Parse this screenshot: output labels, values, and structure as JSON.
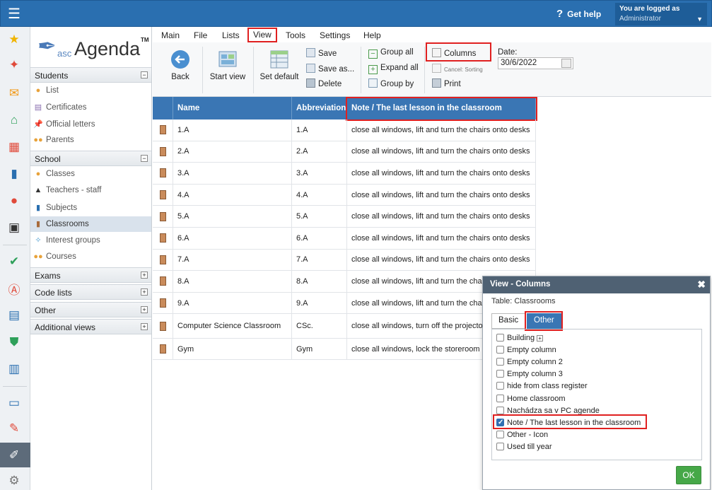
{
  "topbar": {
    "get_help": "Get help",
    "logged_as": "You are logged as",
    "user": "Administrator"
  },
  "logo": {
    "asc": "asc",
    "agenda": "Agenda",
    "tm": "TM"
  },
  "nav": {
    "students": {
      "title": "Students",
      "items": [
        "List",
        "Certificates",
        "Official letters",
        "Parents"
      ]
    },
    "school": {
      "title": "School",
      "items": [
        "Classes",
        "Teachers - staff",
        "Subjects",
        "Classrooms",
        "Interest groups",
        "Courses"
      ]
    },
    "collapsed": [
      "Exams",
      "Code lists",
      "Other",
      "Additional views"
    ]
  },
  "menu": [
    "Main",
    "File",
    "Lists",
    "View",
    "Tools",
    "Settings",
    "Help"
  ],
  "ribbon": {
    "back": "Back",
    "start_view": "Start view",
    "set_default": "Set default",
    "save": "Save",
    "save_as": "Save as...",
    "delete": "Delete",
    "group_all": "Group all",
    "expand_all": "Expand all",
    "group_by": "Group by",
    "columns": "Columns",
    "cancel_sorting": "Cancel: Sorting",
    "print": "Print",
    "date_label": "Date:",
    "date_value": "30/6/2022"
  },
  "grid": {
    "headers": [
      "Name",
      "Abbreviation",
      "Note / The last lesson in the classroom"
    ],
    "rows": [
      {
        "name": "1.A",
        "abbr": "1.A",
        "note": "close all windows, lift and turn the chairs onto desks"
      },
      {
        "name": "2.A",
        "abbr": "2.A",
        "note": "close all windows, lift and turn the chairs onto desks"
      },
      {
        "name": "3.A",
        "abbr": "3.A",
        "note": "close all windows, lift and turn the chairs onto desks"
      },
      {
        "name": "4.A",
        "abbr": "4.A",
        "note": "close all windows, lift and turn the chairs onto desks"
      },
      {
        "name": "5.A",
        "abbr": "5.A",
        "note": "close all windows, lift and turn the chairs onto desks"
      },
      {
        "name": "6.A",
        "abbr": "6.A",
        "note": "close all windows, lift and turn the chairs onto desks"
      },
      {
        "name": "7.A",
        "abbr": "7.A",
        "note": "close all windows, lift and turn the chairs onto desks"
      },
      {
        "name": "8.A",
        "abbr": "8.A",
        "note": "close all windows, lift and turn the chai"
      },
      {
        "name": "9.A",
        "abbr": "9.A",
        "note": "close all windows, lift and turn the chai"
      },
      {
        "name": "Computer Science Classroom",
        "abbr": "CSc.",
        "note": "close all windows, turn off the projector computers"
      },
      {
        "name": "Gym",
        "abbr": "Gym",
        "note": "close all windows, lock the storeroom"
      }
    ]
  },
  "dialog": {
    "title": "View - Columns",
    "table": "Table: Classrooms",
    "tabs": [
      "Basic",
      "Other"
    ],
    "items": [
      {
        "label": "Building",
        "checked": false
      },
      {
        "label": "Empty column",
        "checked": false
      },
      {
        "label": "Empty column 2",
        "checked": false
      },
      {
        "label": "Empty column 3",
        "checked": false
      },
      {
        "label": "hide from class register",
        "checked": false
      },
      {
        "label": "Home classroom",
        "checked": false
      },
      {
        "label": "Nachádza sa v PC agende",
        "checked": false
      },
      {
        "label": "Note / The last lesson in the classroom",
        "checked": true
      },
      {
        "label": "Other - Icon",
        "checked": false
      },
      {
        "label": "Used till year",
        "checked": false
      }
    ],
    "ok": "OK"
  },
  "colors": {
    "accent": "#2a6fb0",
    "header": "#3a76b4",
    "highlight": "#e02020",
    "ok": "#46a848"
  }
}
